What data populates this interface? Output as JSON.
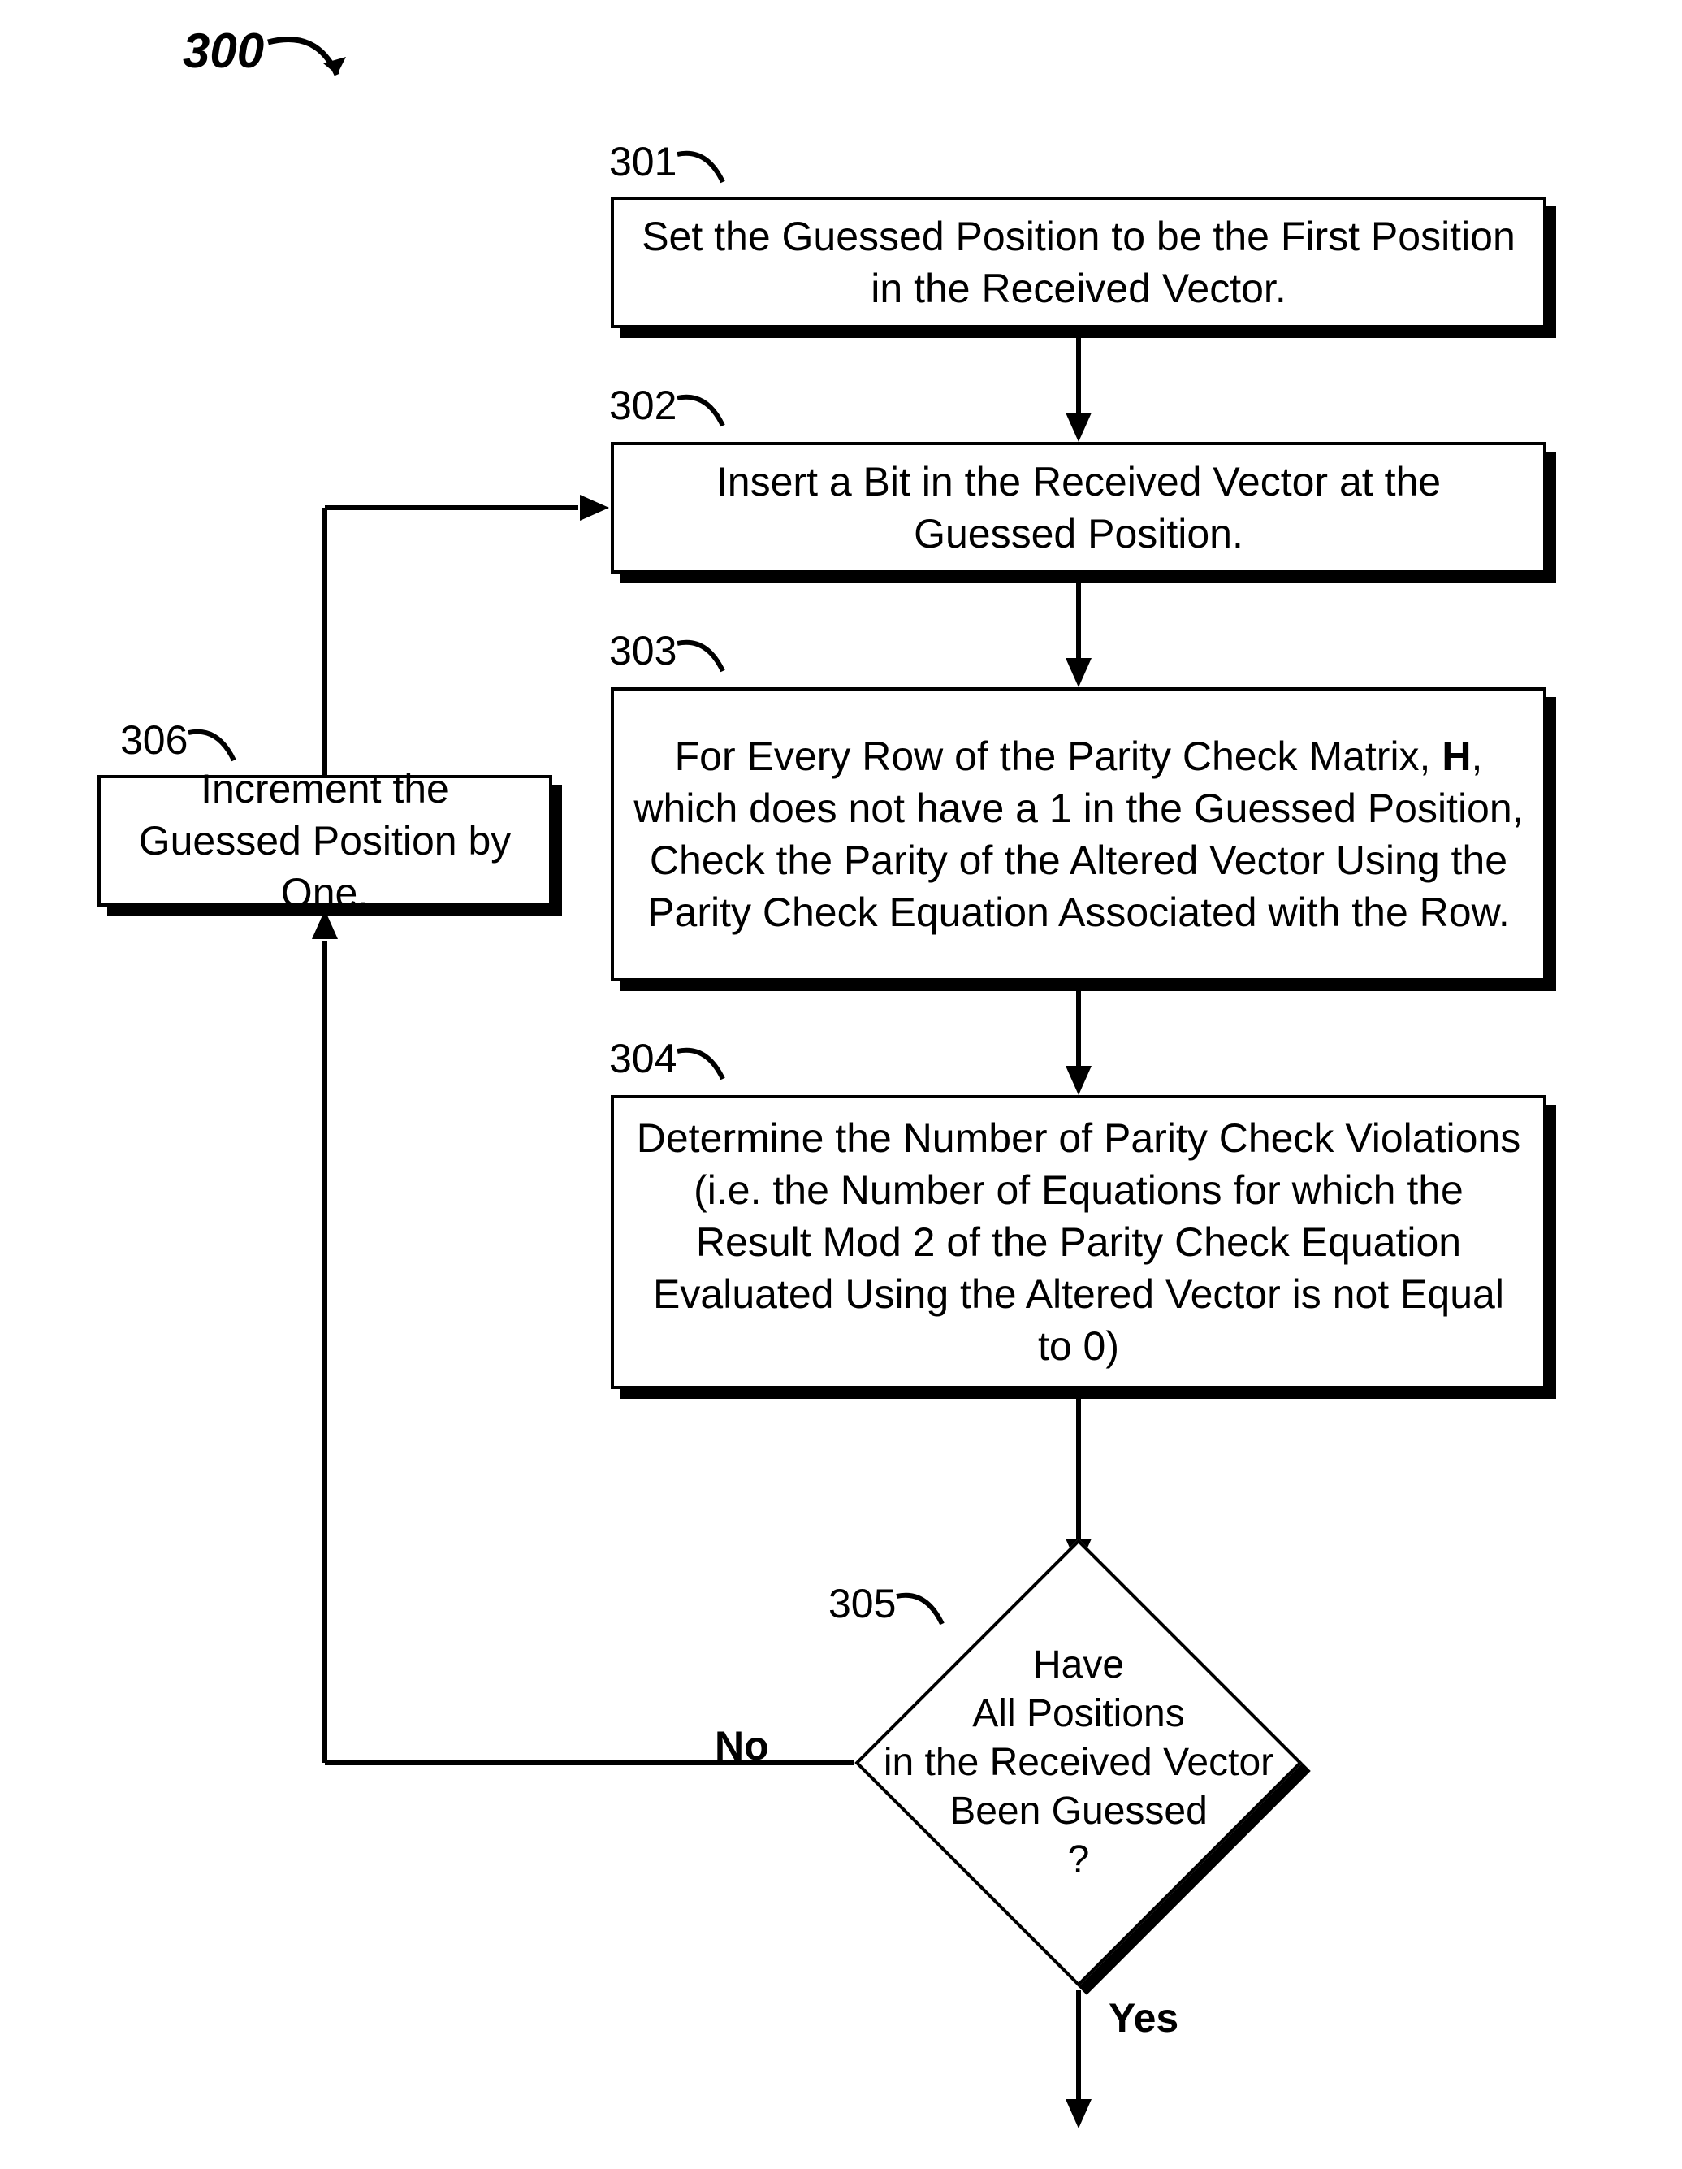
{
  "figure_number": "300",
  "steps": {
    "s301": {
      "num": "301",
      "text": "Set the Guessed Position to be the First Position in the Received Vector."
    },
    "s302": {
      "num": "302",
      "text": "Insert a Bit in the Received Vector at the Guessed Position."
    },
    "s303": {
      "num": "303",
      "text_pre": "For Every Row of the Parity Check Matrix, ",
      "text_bold": "H",
      "text_post": ", which does not have a 1 in the  Guessed Position, Check the Parity of the Altered Vector Using the Parity Check Equation Associated with the Row."
    },
    "s304": {
      "num": "304",
      "text": "Determine the Number of Parity Check Violations (i.e. the Number of Equations for which the Result Mod 2 of the Parity Check Equation Evaluated Using the Altered Vector is not Equal to 0)"
    },
    "s305": {
      "num": "305",
      "text": "Have\nAll Positions\nin the Received Vector\nBeen Guessed\n?"
    },
    "s306": {
      "num": "306",
      "text": "Increment the Guessed Position by One."
    }
  },
  "edges": {
    "no": "No",
    "yes": "Yes"
  }
}
